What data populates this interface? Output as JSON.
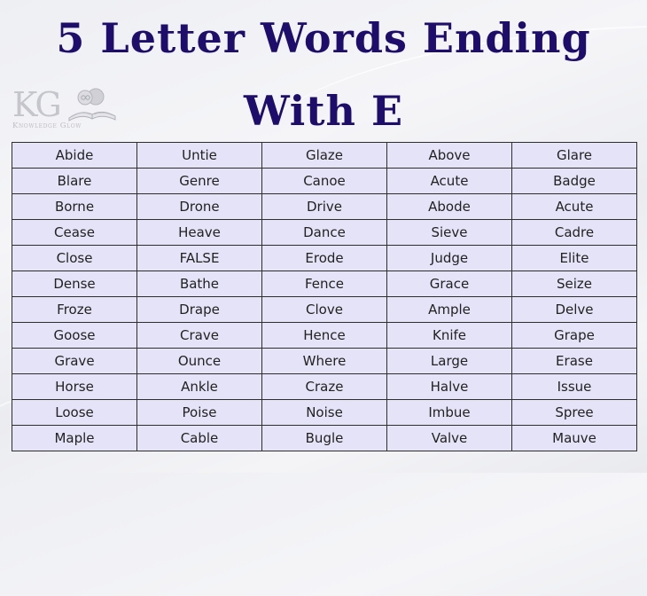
{
  "title": {
    "line1": "5 Letter Words Ending",
    "line2": "With E",
    "color": "#1f0d6b"
  },
  "logo": {
    "initials": "KG",
    "name": "Knowledge Glow",
    "icon": "book-reader-icon"
  },
  "table": {
    "background": "#e5e3f7",
    "rows": [
      [
        "Abide",
        "Untie",
        "Glaze",
        "Above",
        "Glare"
      ],
      [
        "Blare",
        "Genre",
        "Canoe",
        "Acute",
        "Badge"
      ],
      [
        "Borne",
        "Drone",
        "Drive",
        "Abode",
        "Acute"
      ],
      [
        "Cease",
        "Heave",
        "Dance",
        "Sieve",
        "Cadre"
      ],
      [
        "Close",
        "FALSE",
        "Erode",
        "Judge",
        "Elite"
      ],
      [
        "Dense",
        "Bathe",
        "Fence",
        "Grace",
        "Seize"
      ],
      [
        "Froze",
        "Drape",
        "Clove",
        "Ample",
        "Delve"
      ],
      [
        "Goose",
        "Crave",
        "Hence",
        "Knife",
        "Grape"
      ],
      [
        "Grave",
        "Ounce",
        "Where",
        "Large",
        "Erase"
      ],
      [
        "Horse",
        "Ankle",
        "Craze",
        "Halve",
        "Issue"
      ],
      [
        "Loose",
        "Poise",
        "Noise",
        "Imbue",
        "Spree"
      ],
      [
        "Maple",
        "Cable",
        "Bugle",
        "Valve",
        "Mauve"
      ]
    ]
  }
}
